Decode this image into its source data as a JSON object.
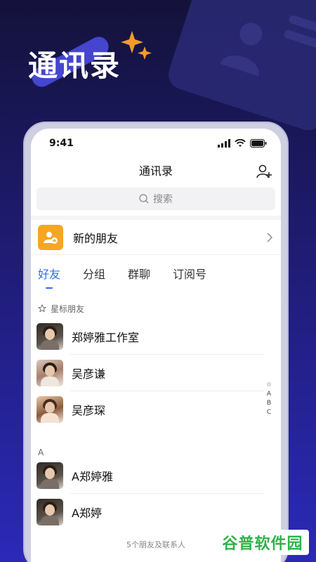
{
  "hero": {
    "title": "通讯录"
  },
  "status": {
    "time": "9:41"
  },
  "nav": {
    "title": "通讯录"
  },
  "search": {
    "placeholder": "搜索"
  },
  "new_friend": {
    "label": "新的朋友"
  },
  "tabs": [
    {
      "label": "好友",
      "active": true
    },
    {
      "label": "分组",
      "active": false
    },
    {
      "label": "群聊",
      "active": false
    },
    {
      "label": "订阅号",
      "active": false
    }
  ],
  "starred": {
    "header": "星标朋友",
    "contacts": [
      {
        "name": "郑婷雅工作室",
        "avatar": "av1"
      },
      {
        "name": "吴彦谦",
        "avatar": "av2"
      },
      {
        "name": "吴彦琛",
        "avatar": "av3"
      }
    ]
  },
  "group_a": {
    "letter": "A",
    "contacts": [
      {
        "name": "A郑婷雅",
        "avatar": "av1"
      },
      {
        "name": "A郑婷",
        "avatar": "av1"
      }
    ]
  },
  "index_bar": [
    "☆",
    "A",
    "B",
    "C"
  ],
  "footer": {
    "count_text": "5个朋友及联系人"
  },
  "watermark": {
    "text": "谷普软件园"
  },
  "colors": {
    "accent": "#2f6fe8",
    "new_friend_icon": "#f5a623"
  }
}
